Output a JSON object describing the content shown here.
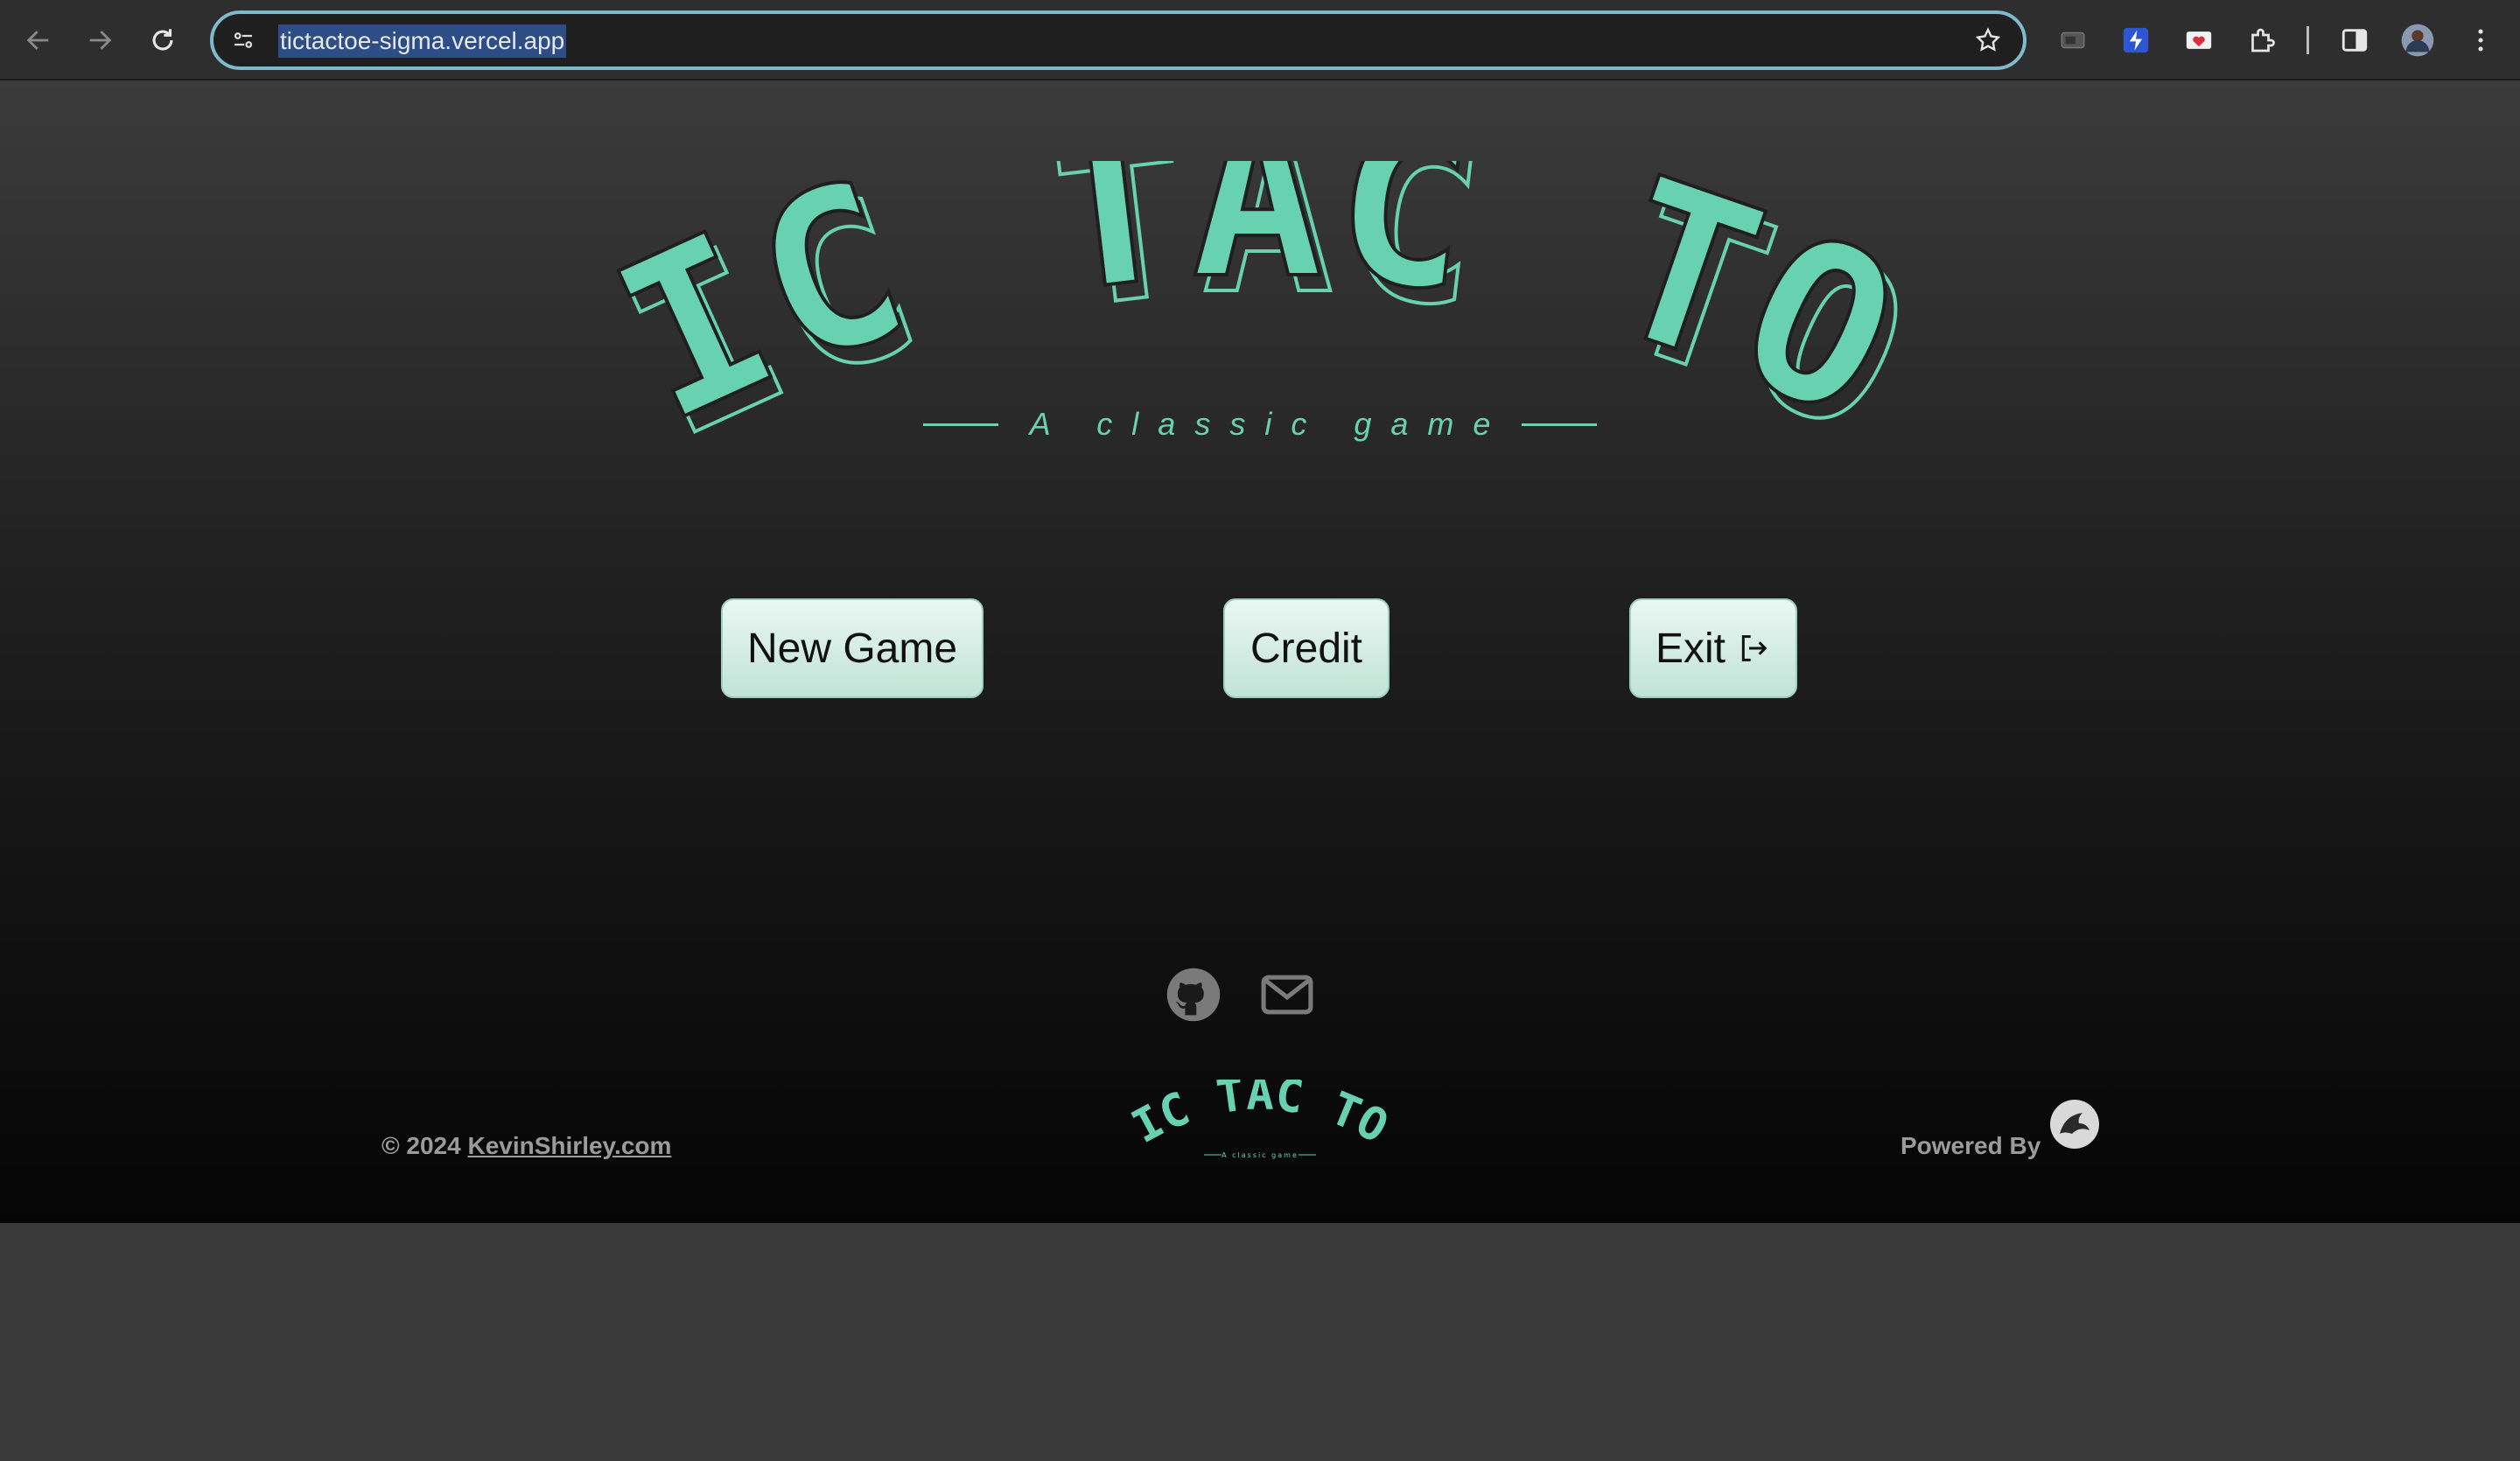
{
  "browser": {
    "url": "tictactoe-sigma.vercel.app",
    "icons": [
      "back-icon",
      "forward-icon",
      "reload-icon",
      "site-info-icon",
      "bookmark-star-icon",
      "extension-icons",
      "puzzle-icon",
      "side-panel-icon",
      "profile-avatar",
      "kebab-menu-icon"
    ]
  },
  "hero": {
    "logo_text": "TIC TAC TOE",
    "subtitle": "A classic game",
    "accent_color": "#68d2b0"
  },
  "menu": {
    "new_game": "New Game",
    "credit": "Credit",
    "exit": "Exit"
  },
  "social": {
    "icons": [
      "github-icon",
      "mail-icon"
    ]
  },
  "footer": {
    "copyright": "© 2024",
    "site_link": "KevinShirley.com",
    "logo_text": "TIC TAC TOE",
    "logo_subtitle": "A classic game",
    "powered_by": "Powered By"
  }
}
